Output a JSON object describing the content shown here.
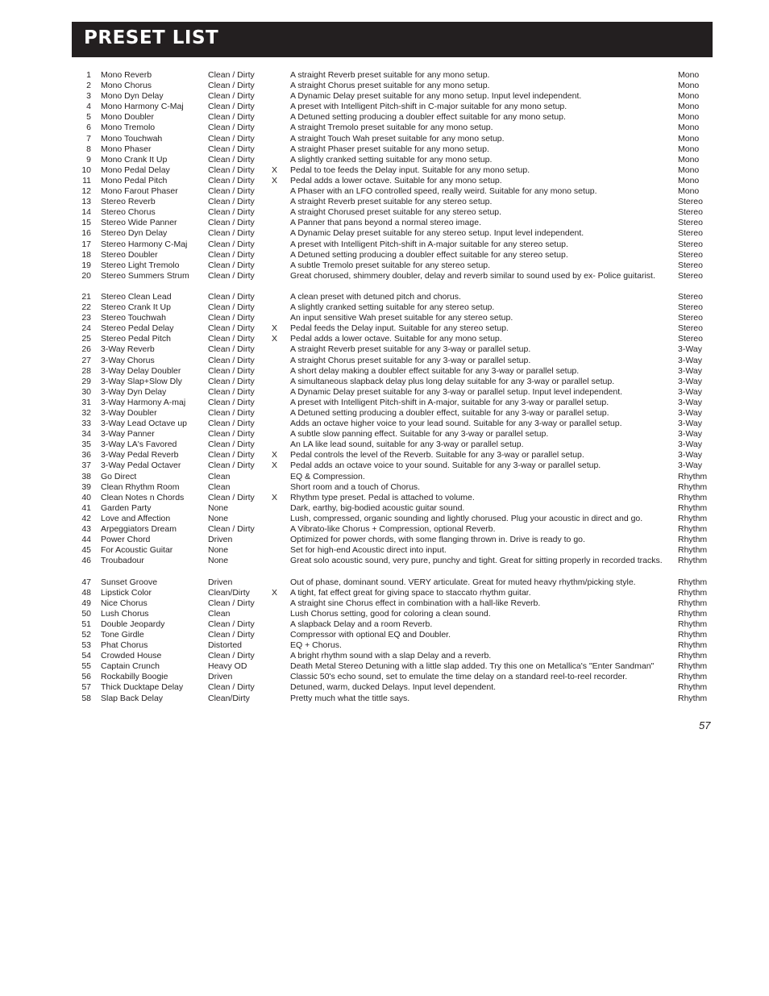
{
  "header": {
    "title": "PRESET LIST"
  },
  "page_number": "57",
  "presets": [
    {
      "num": "1",
      "name": "Mono Reverb",
      "type": "Clean / Dirty",
      "pedal": "",
      "desc": "A straight Reverb preset suitable for any mono setup.",
      "cat": "Mono"
    },
    {
      "num": "2",
      "name": "Mono Chorus",
      "type": "Clean / Dirty",
      "pedal": "",
      "desc": "A straight Chorus preset suitable for any mono setup.",
      "cat": "Mono"
    },
    {
      "num": "3",
      "name": "Mono Dyn Delay",
      "type": "Clean / Dirty",
      "pedal": "",
      "desc": "A Dynamic Delay preset suitable for any mono setup. Input level independent.",
      "cat": "Mono"
    },
    {
      "num": "4",
      "name": "Mono Harmony C-Maj",
      "type": "Clean / Dirty",
      "pedal": "",
      "desc": "A preset with Intelligent Pitch-shift in C-major suitable for any mono setup.",
      "cat": "Mono"
    },
    {
      "num": "5",
      "name": "Mono Doubler",
      "type": "Clean / Dirty",
      "pedal": "",
      "desc": "A Detuned setting producing a doubler effect suitable for any mono setup.",
      "cat": "Mono"
    },
    {
      "num": "6",
      "name": "Mono Tremolo",
      "type": "Clean / Dirty",
      "pedal": "",
      "desc": "A straight Tremolo preset suitable for any mono setup.",
      "cat": "Mono"
    },
    {
      "num": "7",
      "name": "Mono Touchwah",
      "type": "Clean / Dirty",
      "pedal": "",
      "desc": "A straight Touch Wah preset suitable for any mono setup.",
      "cat": "Mono"
    },
    {
      "num": "8",
      "name": "Mono Phaser",
      "type": "Clean / Dirty",
      "pedal": "",
      "desc": "A straight Phaser preset suitable for any mono setup.",
      "cat": "Mono"
    },
    {
      "num": "9",
      "name": "Mono Crank It Up",
      "type": "Clean / Dirty",
      "pedal": "",
      "desc": "A slightly cranked setting suitable for any mono setup.",
      "cat": "Mono"
    },
    {
      "num": "10",
      "name": "Mono Pedal Delay",
      "type": "Clean / Dirty",
      "pedal": "X",
      "desc": "Pedal to toe feeds the Delay input. Suitable for any mono setup.",
      "cat": "Mono"
    },
    {
      "num": "11",
      "name": "Mono Pedal Pitch",
      "type": "Clean / Dirty",
      "pedal": "X",
      "desc": "Pedal adds a lower octave. Suitable for any mono setup.",
      "cat": "Mono"
    },
    {
      "num": "12",
      "name": "Mono Farout Phaser",
      "type": "Clean / Dirty",
      "pedal": "",
      "desc": "A Phaser with an LFO controlled speed, really weird. Suitable for any mono setup.",
      "cat": "Mono"
    },
    {
      "num": "13",
      "name": "Stereo Reverb",
      "type": "Clean / Dirty",
      "pedal": "",
      "desc": "A straight Reverb preset suitable for any stereo setup.",
      "cat": "Stereo"
    },
    {
      "num": "14",
      "name": "Stereo Chorus",
      "type": "Clean / Dirty",
      "pedal": "",
      "desc": "A straight Chorused preset suitable for any stereo setup.",
      "cat": "Stereo"
    },
    {
      "num": "15",
      "name": "Stereo Wide Panner",
      "type": "Clean / Dirty",
      "pedal": "",
      "desc": "A Panner that pans beyond a normal stereo image.",
      "cat": "Stereo"
    },
    {
      "num": "16",
      "name": "Stereo Dyn Delay",
      "type": "Clean / Dirty",
      "pedal": "",
      "desc": "A Dynamic Delay preset suitable for any stereo setup. Input level independent.",
      "cat": "Stereo"
    },
    {
      "num": "17",
      "name": "Stereo Harmony C-Maj",
      "type": "Clean / Dirty",
      "pedal": "",
      "desc": "A preset with Intelligent Pitch-shift in A-major suitable for any stereo setup.",
      "cat": "Stereo"
    },
    {
      "num": "18",
      "name": "Stereo Doubler",
      "type": "Clean / Dirty",
      "pedal": "",
      "desc": "A Detuned setting producing a doubler effect suitable for any stereo setup.",
      "cat": "Stereo"
    },
    {
      "num": "19",
      "name": "Stereo Light Tremolo",
      "type": "Clean / Dirty",
      "pedal": "",
      "desc": "A subtle Tremolo preset suitable for any stereo setup.",
      "cat": "Stereo"
    },
    {
      "num": "20",
      "name": "Stereo Summers Strum",
      "type": "Clean / Dirty",
      "pedal": "",
      "desc": "Great chorused, shimmery doubler, delay and reverb similar to sound used by ex- Police guitarist.",
      "cat": "Stereo",
      "lines": 2
    },
    {
      "num": "21",
      "name": "Stereo Clean Lead",
      "type": "Clean / Dirty",
      "pedal": "",
      "desc": "A clean preset with detuned pitch and chorus.",
      "cat": "Stereo"
    },
    {
      "num": "22",
      "name": "Stereo Crank It Up",
      "type": "Clean / Dirty",
      "pedal": "",
      "desc": "A slightly cranked setting suitable for any stereo setup.",
      "cat": "Stereo"
    },
    {
      "num": "23",
      "name": "Stereo Touchwah",
      "type": "Clean / Dirty",
      "pedal": "",
      "desc": "An input sensitive Wah preset suitable for any stereo setup.",
      "cat": "Stereo"
    },
    {
      "num": "24",
      "name": "Stereo Pedal Delay",
      "type": "Clean / Dirty",
      "pedal": "X",
      "desc": "Pedal feeds the Delay input. Suitable for any stereo setup.",
      "cat": "Stereo"
    },
    {
      "num": "25",
      "name": "Stereo Pedal Pitch",
      "type": "Clean / Dirty",
      "pedal": "X",
      "desc": "Pedal adds a lower octave. Suitable for any mono setup.",
      "cat": "Stereo"
    },
    {
      "num": "26",
      "name": "3-Way Reverb",
      "type": "Clean / Dirty",
      "pedal": "",
      "desc": "A straight Reverb preset suitable for any 3-way or parallel setup.",
      "cat": "3-Way"
    },
    {
      "num": "27",
      "name": "3-Way Chorus",
      "type": "Clean / Dirty",
      "pedal": "",
      "desc": "A straight Chorus preset suitable for any 3-way or parallel setup.",
      "cat": "3-Way"
    },
    {
      "num": "28",
      "name": "3-Way Delay Doubler",
      "type": "Clean / Dirty",
      "pedal": "",
      "desc": "A short delay making a doubler effect suitable for any 3-way or parallel setup.",
      "cat": "3-Way"
    },
    {
      "num": "29",
      "name": "3-Way Slap+Slow Dly",
      "type": "Clean / Dirty",
      "pedal": "",
      "desc": "A simultaneous slapback delay plus long delay suitable for any 3-way or parallel setup.",
      "cat": "3-Way"
    },
    {
      "num": "30",
      "name": "3-Way Dyn Delay",
      "type": "Clean / Dirty",
      "pedal": "",
      "desc": "A Dynamic Delay preset suitable for any 3-way or parallel setup. Input level independent.",
      "cat": "3-Way"
    },
    {
      "num": "31",
      "name": "3-Way Harmony A-maj",
      "type": "Clean / Dirty",
      "pedal": "",
      "desc": "A preset with Intelligent Pitch-shift in A-major, suitable for any 3-way or parallel setup.",
      "cat": "3-Way"
    },
    {
      "num": "32",
      "name": "3-Way Doubler",
      "type": "Clean / Dirty",
      "pedal": "",
      "desc": "A Detuned setting producing a doubler effect, suitable for any 3-way or parallel setup.",
      "cat": "3-Way"
    },
    {
      "num": "33",
      "name": "3-Way Lead Octave up",
      "type": "Clean / Dirty",
      "pedal": "",
      "desc": "Adds an octave higher voice to your lead sound. Suitable for any 3-way or parallel setup.",
      "cat": "3-Way"
    },
    {
      "num": "34",
      "name": "3-Way Panner",
      "type": "Clean / Dirty",
      "pedal": "",
      "desc": "A subtle slow panning effect. Suitable for any 3-way or parallel setup.",
      "cat": "3-Way"
    },
    {
      "num": "35",
      "name": "3-Way LA's Favored",
      "type": "Clean / Dirty",
      "pedal": "",
      "desc": "An LA like lead sound, suitable for any 3-way or parallel setup.",
      "cat": "3-Way"
    },
    {
      "num": "36",
      "name": "3-Way Pedal Reverb",
      "type": "Clean / Dirty",
      "pedal": "X",
      "desc": "Pedal controls the level of the Reverb. Suitable for any 3-way or parallel setup.",
      "cat": "3-Way"
    },
    {
      "num": "37",
      "name": "3-Way Pedal Octaver",
      "type": "Clean / Dirty",
      "pedal": "X",
      "desc": "Pedal adds an octave voice to your sound. Suitable for any 3-way or parallel setup.",
      "cat": "3-Way"
    },
    {
      "num": "38",
      "name": "Go Direct",
      "type": "Clean",
      "pedal": "",
      "desc": "EQ & Compression.",
      "cat": "Rhythm"
    },
    {
      "num": "39",
      "name": "Clean Rhythm Room",
      "type": "Clean",
      "pedal": "",
      "desc": "Short room and a touch of Chorus.",
      "cat": "Rhythm"
    },
    {
      "num": "40",
      "name": "Clean Notes n Chords",
      "type": "Clean / Dirty",
      "pedal": "X",
      "desc": "Rhythm type preset. Pedal is attached to volume.",
      "cat": "Rhythm"
    },
    {
      "num": "41",
      "name": "Garden Party",
      "type": "None",
      "pedal": "",
      "desc": "Dark, earthy, big-bodied acoustic guitar sound.",
      "cat": "Rhythm"
    },
    {
      "num": "42",
      "name": "Love and Affection",
      "type": "None",
      "pedal": "",
      "desc": "Lush, compressed, organic sounding and lightly chorused. Plug your acoustic in direct and go.",
      "cat": "Rhythm"
    },
    {
      "num": "43",
      "name": "Arpeggiators Dream",
      "type": "Clean / Dirty",
      "pedal": "",
      "desc": "A Vibrato-like Chorus + Compression, optional Reverb.",
      "cat": "Rhythm"
    },
    {
      "num": "44",
      "name": "Power Chord",
      "type": "Driven",
      "pedal": "",
      "desc": "Optimized for power chords, with some flanging thrown in. Drive is ready to go.",
      "cat": "Rhythm"
    },
    {
      "num": "45",
      "name": "For Acoustic Guitar",
      "type": "None",
      "pedal": "",
      "desc": "Set for high-end Acoustic direct into input.",
      "cat": "Rhythm"
    },
    {
      "num": "46",
      "name": "Troubadour",
      "type": "None",
      "pedal": "",
      "desc": "Great solo acoustic sound, very pure, punchy and tight. Great for sitting properly in recorded tracks.",
      "cat": "Rhythm",
      "lines": 2
    },
    {
      "num": "47",
      "name": "Sunset Groove",
      "type": "Driven",
      "pedal": "",
      "desc": "Out of phase, dominant sound. VERY articulate. Great for muted heavy rhythm/picking style.",
      "cat": "Rhythm"
    },
    {
      "num": "48",
      "name": "Lipstick Color",
      "type": "Clean/Dirty",
      "pedal": "X",
      "desc": "A tight, fat effect great for giving space to staccato rhythm guitar.",
      "cat": "Rhythm"
    },
    {
      "num": "49",
      "name": "Nice Chorus",
      "type": "Clean / Dirty",
      "pedal": "",
      "desc": "A straight sine Chorus effect in combination with a hall-like Reverb.",
      "cat": "Rhythm"
    },
    {
      "num": "50",
      "name": "Lush Chorus",
      "type": "Clean",
      "pedal": "",
      "desc": "Lush Chorus setting, good for coloring a clean sound.",
      "cat": "Rhythm"
    },
    {
      "num": "51",
      "name": "Double Jeopardy",
      "type": "Clean / Dirty",
      "pedal": "",
      "desc": "A slapback Delay and a room Reverb.",
      "cat": "Rhythm"
    },
    {
      "num": "52",
      "name": "Tone Girdle",
      "type": "Clean / Dirty",
      "pedal": "",
      "desc": "Compressor with optional EQ and Doubler.",
      "cat": "Rhythm"
    },
    {
      "num": "53",
      "name": "Phat Chorus",
      "type": "Distorted",
      "pedal": "",
      "desc": "EQ + Chorus.",
      "cat": "Rhythm"
    },
    {
      "num": "54",
      "name": "Crowded House",
      "type": "Clean / Dirty",
      "pedal": "",
      "desc": "A bright rhythm sound with a slap Delay and a reverb.",
      "cat": "Rhythm"
    },
    {
      "num": "55",
      "name": "Captain Crunch",
      "type": "Heavy OD",
      "pedal": "",
      "desc": "Death Metal Stereo Detuning with a little slap added. Try this one on Metallica's \"Enter Sandman\"",
      "cat": "Rhythm"
    },
    {
      "num": "56",
      "name": "Rockabilly Boogie",
      "type": "Driven",
      "pedal": "",
      "desc": "Classic 50's echo sound, set to emulate the time delay on a standard reel-to-reel recorder.",
      "cat": "Rhythm"
    },
    {
      "num": "57",
      "name": "Thick Ducktape Delay",
      "type": "Clean / Dirty",
      "pedal": "",
      "desc": "Detuned, warm,  ducked Delays. Input level dependent.",
      "cat": "Rhythm"
    },
    {
      "num": "58",
      "name": "Slap Back Delay",
      "type": "Clean/Dirty",
      "pedal": "",
      "desc": "Pretty much what the tittle says.",
      "cat": "Rhythm"
    }
  ]
}
